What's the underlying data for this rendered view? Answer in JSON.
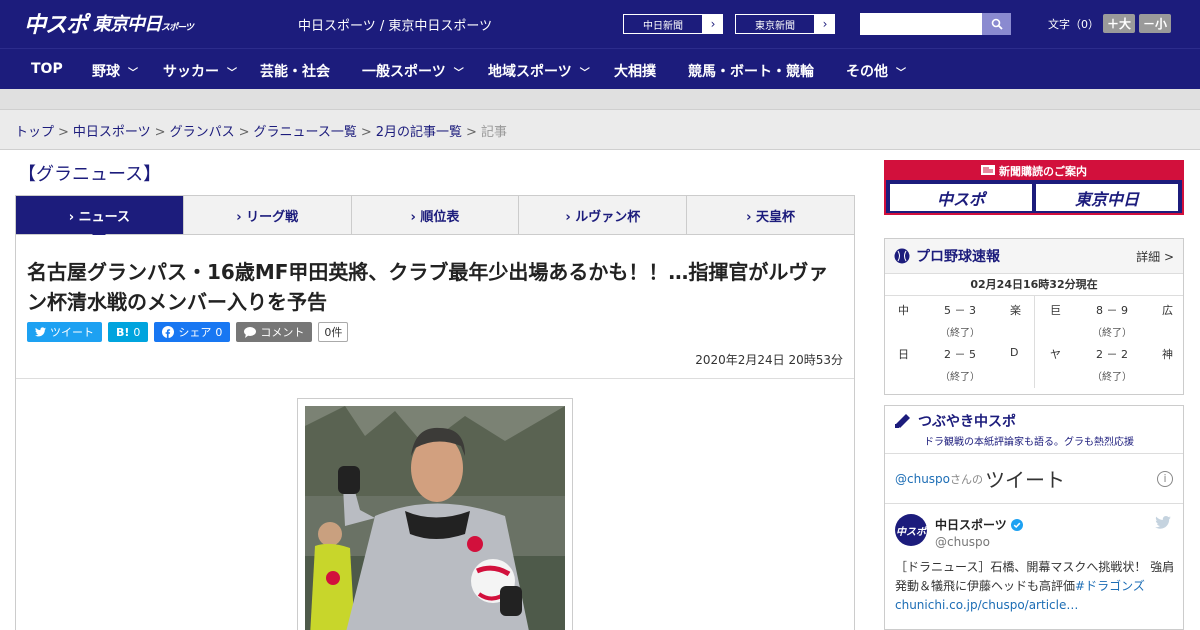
{
  "header": {
    "logo_main": "中スポ",
    "logo_sub": "東京中日",
    "logo_sub_small": "スポーツ",
    "site_title": "中日スポーツ / 東京中日スポーツ",
    "ext_links": [
      {
        "label": "中日新聞",
        "arrow": "›"
      },
      {
        "label": "東京新聞",
        "arrow": "›"
      }
    ],
    "search_placeholder": "",
    "font_label": "文字（0）",
    "font_bigger": "＋大",
    "font_smaller": "－小"
  },
  "nav": {
    "items": [
      {
        "label": "TOP",
        "dropdown": false
      },
      {
        "label": "野球",
        "dropdown": true
      },
      {
        "label": "サッカー",
        "dropdown": true
      },
      {
        "label": "芸能・社会",
        "dropdown": false
      },
      {
        "label": "一般スポーツ",
        "dropdown": true
      },
      {
        "label": "地域スポーツ",
        "dropdown": true
      },
      {
        "label": "大相撲",
        "dropdown": false
      },
      {
        "label": "競馬・ボート・競輪",
        "dropdown": false
      },
      {
        "label": "その他",
        "dropdown": true
      }
    ]
  },
  "breadcrumb": {
    "items": [
      "トップ",
      "中日スポーツ",
      "グランパス",
      "グラニュース一覧",
      "2月の記事一覧"
    ],
    "current": "記事",
    "separator": ">"
  },
  "section": {
    "heading": "【グラニュース】"
  },
  "tabs": [
    {
      "label": "› ニュース",
      "active": true
    },
    {
      "label": "› リーグ戦",
      "active": false
    },
    {
      "label": "› 順位表",
      "active": false
    },
    {
      "label": "› ルヴァン杯",
      "active": false
    },
    {
      "label": "› 天皇杯",
      "active": false
    }
  ],
  "article": {
    "headline": "名古屋グランパス・16歳MF甲田英將、クラブ最年少出場あるかも！！…指揮官がルヴァン杯清水戦のメンバー入りを予告",
    "share": {
      "tweet": "ツイート",
      "hatena_label": "B!",
      "hatena_count": "0",
      "facebook": "シェア",
      "facebook_count": "0",
      "comment": "コメント",
      "comment_count": "0件"
    },
    "date": "2020年2月24日 20時53分"
  },
  "sidebar": {
    "promo_title": "新聞購読のご案内",
    "promo_logo_1": "中スポ",
    "promo_logo_2": "東京中日",
    "baseball": {
      "title": "プロ野球速報",
      "more": "詳細 >",
      "timestamp": "02月24日16時32分現在",
      "games": [
        {
          "home": "中",
          "score": "5 － 3",
          "away": "楽",
          "status": "（終了）"
        },
        {
          "home": "巨",
          "score": "8 － 9",
          "away": "広",
          "status": "（終了）"
        },
        {
          "home": "日",
          "score": "2 － 5",
          "away": "D",
          "status": "（終了）"
        },
        {
          "home": "ヤ",
          "score": "2 － 2",
          "away": "神",
          "status": "（終了）"
        }
      ]
    },
    "tsubuyaki": {
      "title": "つぶやき中スポ",
      "subtitle": "ドラ観戦の本紙評論家も語る。グラも熱烈応援"
    },
    "twitter": {
      "handle": "@chuspo",
      "san": "さんの",
      "title": "ツイート",
      "info": "i",
      "avatar_text": "中スポ",
      "name": "中日スポーツ",
      "screen_name": "@chuspo",
      "body_text": "［ドラニュース］石橋、開幕マスクへ挑戦状！ 強肩発動＆犠飛に伊藤ヘッドも高評価",
      "hashtag": "#ドラゴンズ",
      "link": "chunichi.co.jp/chuspo/article…"
    }
  },
  "colors": {
    "brand_navy": "#1c1c7c",
    "promo_red": "#d2103c",
    "twitter_blue": "#1da1f2",
    "facebook_blue": "#1877f2"
  }
}
